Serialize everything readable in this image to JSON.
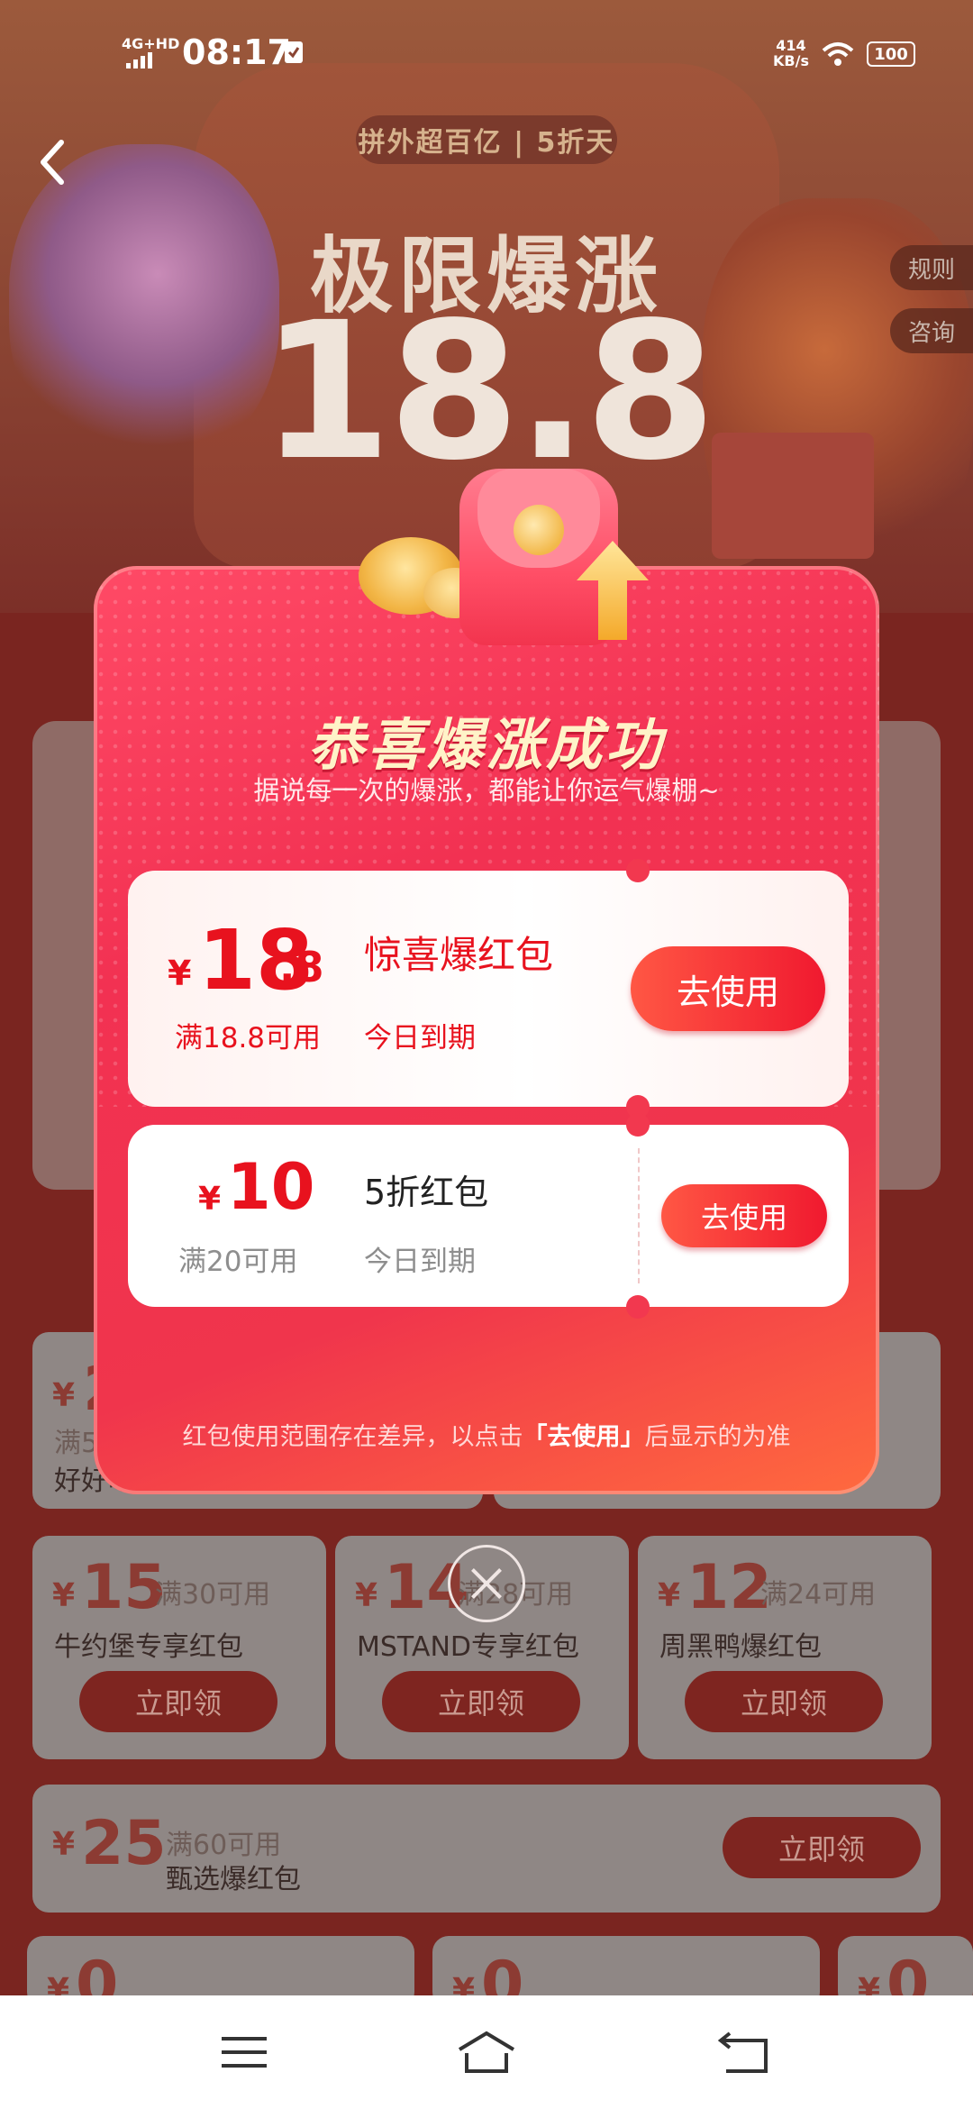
{
  "status_bar": {
    "network": "4G+HD",
    "time": "08:17",
    "speed_value": "414",
    "speed_unit": "KB/s",
    "battery": "100"
  },
  "header": {
    "banner": "拼外超百亿 | 5折天",
    "title": "极限爆涨",
    "number": "18.8",
    "side_tabs": [
      "规则",
      "咨询"
    ]
  },
  "background_coupons": {
    "row1": [
      {
        "yen": "¥",
        "value": "2",
        "cond": "满5",
        "name": "好好吃"
      }
    ],
    "row2": [
      {
        "yen": "¥",
        "value": "15",
        "cond": "满30可用",
        "name": "牛约堡专享红包",
        "btn": "立即领"
      },
      {
        "yen": "¥",
        "value": "14",
        "cond": "满28可用",
        "name": "MSTAND专享红包",
        "btn": "立即领"
      },
      {
        "yen": "¥",
        "value": "12",
        "cond": "满24可用",
        "name": "周黑鸭爆红包",
        "btn": "立即领"
      }
    ],
    "row3": {
      "yen": "¥",
      "value": "25",
      "cond": "满60可用",
      "name": "甄选爆红包",
      "btn": "立即领"
    },
    "row4": [
      {
        "yen": "¥",
        "value": "0"
      },
      {
        "yen": "¥",
        "value": "0"
      },
      {
        "yen": "¥",
        "value": "0"
      }
    ]
  },
  "dialog": {
    "title": "恭喜爆涨成功",
    "subtitle": "据说每一次的爆涨，都能让你运气爆棚~",
    "coupons": [
      {
        "yen": "¥",
        "int": "18",
        "dec": ".8",
        "cond": "满18.8可用",
        "name": "惊喜爆红包",
        "expiry": "今日到期",
        "button": "去使用"
      },
      {
        "yen": "¥",
        "int": "10",
        "dec": "",
        "cond": "满20可用",
        "name": "5折红包",
        "expiry": "今日到期",
        "button": "去使用"
      }
    ],
    "note_before": "红包使用范围存在差异，以点击",
    "note_bold": "「去使用」",
    "note_after": "后显示的为准"
  },
  "colors": {
    "dialog_red": "#f23152",
    "coupon_red": "#e8121e",
    "title_gold": "#fff3c8"
  },
  "icons": [
    "back-arrow-icon",
    "close-icon",
    "menu-icon",
    "home-icon",
    "return-icon",
    "wifi-icon",
    "signal-icon"
  ]
}
